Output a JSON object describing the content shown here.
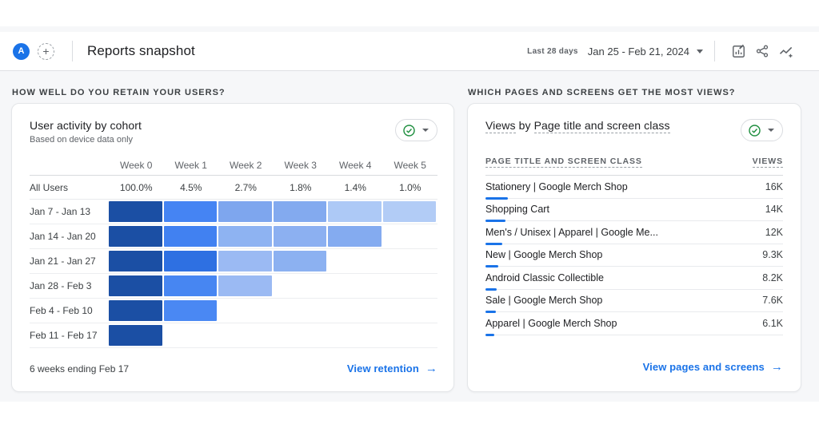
{
  "header": {
    "avatar_letter": "A",
    "add_comparison_label": "+",
    "title": "Reports snapshot",
    "date_range_label": "Last 28 days",
    "date_range_value": "Jan 25 - Feb 21, 2024",
    "icons": [
      "customize-report",
      "share",
      "insights"
    ]
  },
  "colors": {
    "accent_blue": "#1a73e8",
    "link_blue": "#1a73e8",
    "badge_green": "#1e8e3e",
    "icon_gray": "#5f6368"
  },
  "retention_card": {
    "section_label": "HOW WELL DO YOU RETAIN YOUR USERS?",
    "title": "User activity by cohort",
    "subtitle": "Based on device data only",
    "status_icon": "green-check",
    "footer_note": "6 weeks ending Feb 17",
    "link_label": "View retention",
    "link_arrow": "→"
  },
  "chart_data": {
    "type": "heatmap",
    "title": "User activity by cohort",
    "columns": [
      "Week 0",
      "Week 1",
      "Week 2",
      "Week 3",
      "Week 4",
      "Week 5"
    ],
    "all_users": {
      "label": "All Users",
      "values": [
        "100.0%",
        "4.5%",
        "2.7%",
        "1.8%",
        "1.4%",
        "1.0%"
      ]
    },
    "cohorts": [
      {
        "label": "Jan 7 - Jan 13",
        "cells": [
          "#1b4fa4",
          "#4584f3",
          "#7ea6ee",
          "#83aaef",
          "#adc9f6",
          "#b2ccf6"
        ]
      },
      {
        "label": "Jan 14 - Jan 20",
        "cells": [
          "#1b4fa4",
          "#4181f1",
          "#8eb3f2",
          "#8cb0f1",
          "#84abf0"
        ]
      },
      {
        "label": "Jan 21 - Jan 27",
        "cells": [
          "#1b4fa4",
          "#2e70e2",
          "#9bbaf3",
          "#8cb1f1"
        ]
      },
      {
        "label": "Jan 28 - Feb 3",
        "cells": [
          "#1b4fa4",
          "#4786f2",
          "#9bbaf3"
        ]
      },
      {
        "label": "Feb 4 - Feb 10",
        "cells": [
          "#1b4fa4",
          "#4a88f3"
        ]
      },
      {
        "label": "Feb 11 - Feb 17",
        "cells": [
          "#1b4fa4"
        ]
      }
    ]
  },
  "pages_card": {
    "section_label": "WHICH PAGES AND SCREENS GET THE MOST VIEWS?",
    "title_metric": "Views",
    "title_joiner": " by ",
    "title_dimension": "Page title and screen class",
    "status_icon": "green-check",
    "col_header_dimension": "PAGE TITLE AND SCREEN CLASS",
    "col_header_metric": "VIEWS",
    "rows": [
      {
        "label": "Stationery | Google Merch Shop",
        "views_label": "16K",
        "views_k": 16
      },
      {
        "label": "Shopping Cart",
        "views_label": "14K",
        "views_k": 14
      },
      {
        "label": "Men's / Unisex | Apparel | Google Me...",
        "views_label": "12K",
        "views_k": 12
      },
      {
        "label": "New | Google Merch Shop",
        "views_label": "9.3K",
        "views_k": 9.3
      },
      {
        "label": "Android Classic Collectible",
        "views_label": "8.2K",
        "views_k": 8.2
      },
      {
        "label": "Sale | Google Merch Shop",
        "views_label": "7.6K",
        "views_k": 7.6
      },
      {
        "label": "Apparel | Google Merch Shop",
        "views_label": "6.1K",
        "views_k": 6.1
      }
    ],
    "link_label": "View pages and screens",
    "link_arrow": "→"
  }
}
